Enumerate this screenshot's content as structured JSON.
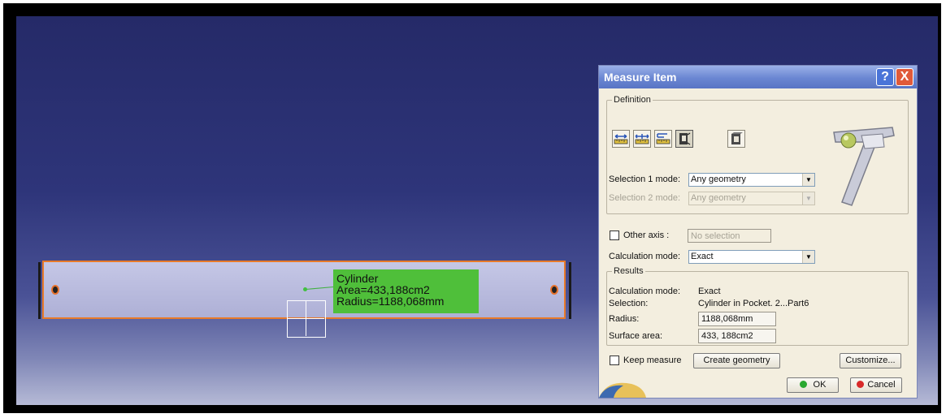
{
  "viewport": {
    "annotation": {
      "line1": "Cylinder",
      "line2": "Area=433,188cm2",
      "line3": "Radius=1188,068mm"
    }
  },
  "dialog": {
    "title": "Measure Item",
    "help_label": "?",
    "close_label": "X",
    "definition": {
      "legend": "Definition",
      "tools": [
        "measure-between-icon",
        "measure-between-chain-icon",
        "measure-between-fan-icon",
        "measure-item-icon",
        "measure-thickness-icon"
      ],
      "selection1_label": "Selection 1 mode:",
      "selection1_value": "Any geometry",
      "selection2_label": "Selection 2 mode:",
      "selection2_value": "Any geometry",
      "other_axis_label": "Other axis :",
      "other_axis_placeholder": "No selection",
      "calc_mode_label": "Calculation mode:",
      "calc_mode_value": "Exact"
    },
    "results": {
      "legend": "Results",
      "calc_mode_label": "Calculation mode:",
      "calc_mode_value": "Exact",
      "selection_label": "Selection:",
      "selection_value": "Cylinder in Pocket. 2...Part6",
      "radius_label": "Radius:",
      "radius_value": "1188,068mm",
      "surface_area_label": "Surface area:",
      "surface_area_value": "433, 188cm2"
    },
    "keep_measure_label": "Keep measure",
    "create_geometry_label": "Create geometry",
    "customize_label": "Customize...",
    "ok_label": "OK",
    "cancel_label": "Cancel"
  },
  "colors": {
    "titlebar": "#6a86d2",
    "dialog_bg": "#f3eedf",
    "annotation_bg": "#4fbf3a",
    "part_outline": "#e87a2a"
  }
}
